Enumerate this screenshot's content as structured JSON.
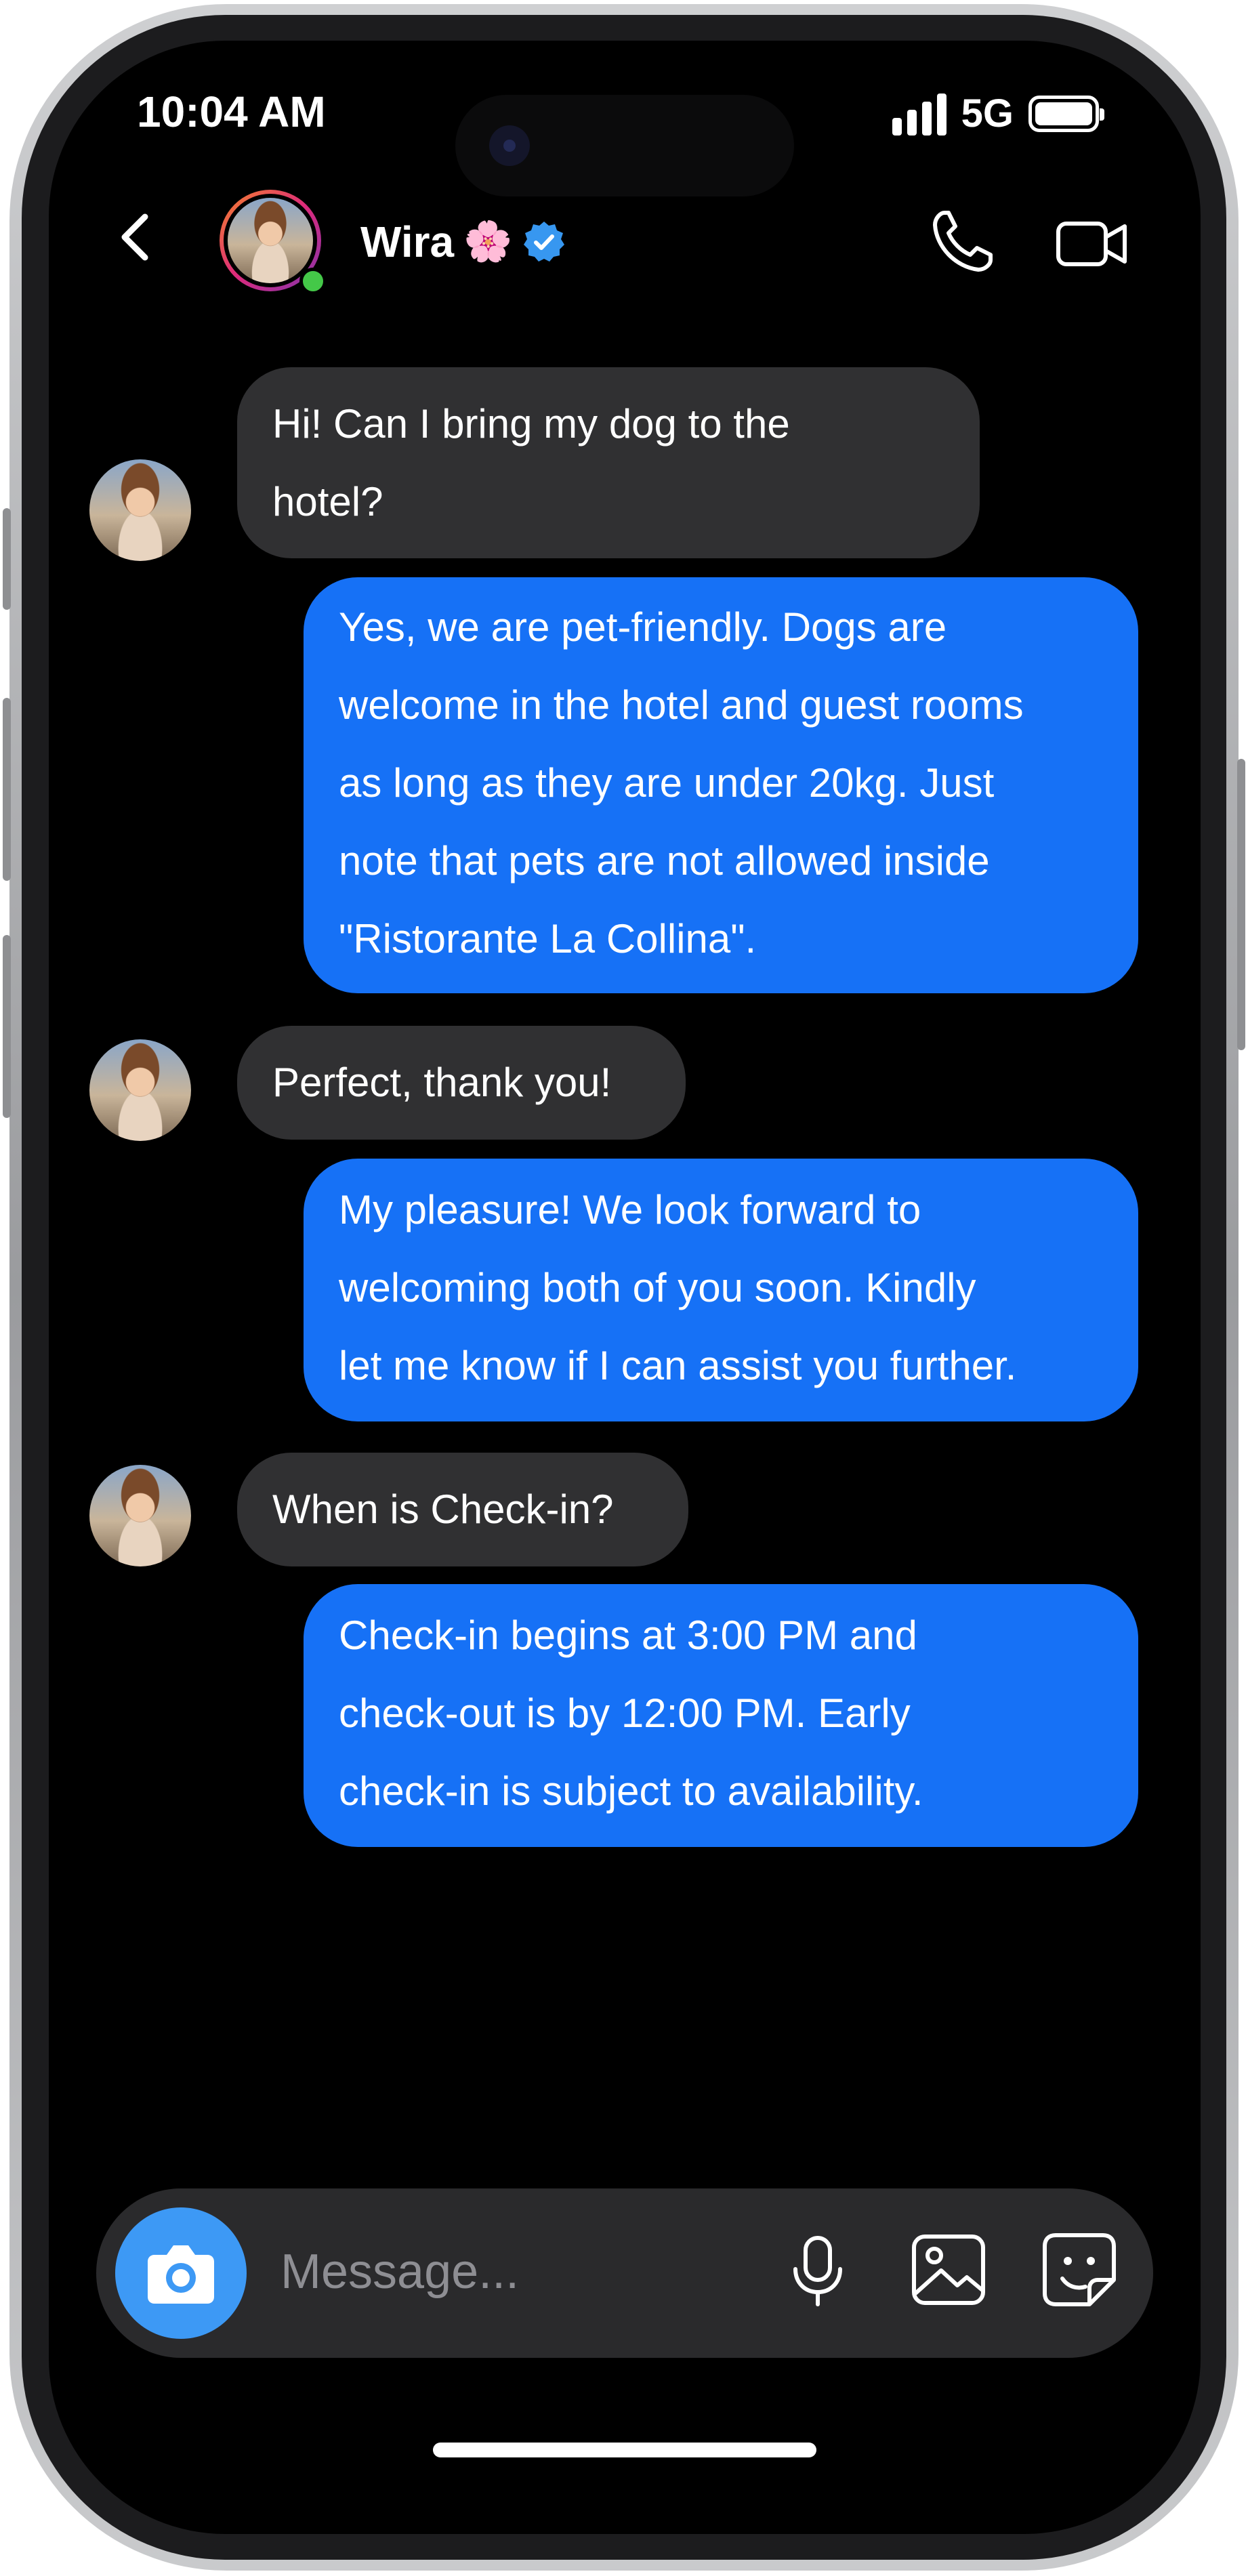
{
  "status_bar": {
    "time": "10:04 AM",
    "network": "5G"
  },
  "header": {
    "contact_name": "Wira",
    "name_emoji": "🌸"
  },
  "messages": [
    {
      "from": "contact",
      "lines": [
        "Hi! Can I bring my dog to the",
        "hotel?"
      ]
    },
    {
      "from": "me",
      "lines": [
        "Yes, we are pet-friendly. Dogs are",
        "welcome in the hotel and guest rooms",
        "as long as they are under 20kg. Just",
        "note that pets are not allowed inside",
        "\"Ristorante La Collina\"."
      ]
    },
    {
      "from": "contact",
      "lines": [
        "Perfect, thank you!"
      ]
    },
    {
      "from": "me",
      "lines": [
        "My pleasure! We look forward to",
        "welcoming both of you soon. Kindly",
        "let me know if I can assist you further."
      ]
    },
    {
      "from": "contact",
      "lines": [
        "When is Check-in?"
      ]
    },
    {
      "from": "me",
      "lines": [
        "Check-in begins at 3:00 PM and",
        "check-out is by 12:00 PM. Early",
        "check-in is subject to availability."
      ]
    }
  ],
  "composer": {
    "placeholder": "Message..."
  },
  "colors": {
    "incoming_bubble": "#303032",
    "outgoing_bubble": "#1671f6",
    "camera_button": "#3d99f5",
    "online_dot": "#44c848"
  }
}
